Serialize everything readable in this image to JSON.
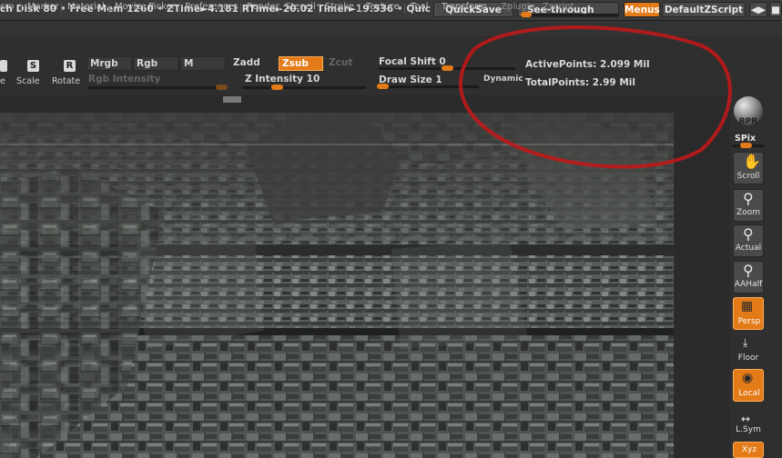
{
  "status_bar": {
    "disk": "ch Disk 80",
    "sep1": "•",
    "free_mem": "Free Mem 1260",
    "sep2": "•",
    "ztime": "ZTime►4.181",
    "rtime": "RTime►20.02",
    "timer": "Timer►19.536",
    "sep3": "•",
    "quick": "Quic"
  },
  "top_buttons": {
    "quicksave": "QuickSave",
    "see_through_label": "See-through",
    "see_through_value": "0",
    "see_through_fraction": 0,
    "menus": "Menus",
    "default_zscript": "DefaultZScript"
  },
  "menu_items": [
    "cro",
    "Marker",
    "Material",
    "Movie",
    "Picker",
    "Preferences",
    "Render",
    "Stencil",
    "Stroke",
    "Texture",
    "Tool",
    "Transform",
    "Zplugin",
    "Zscript"
  ],
  "tools": {
    "scale_label": "Scale",
    "rotate_label": "Rotate",
    "scale_key": "S",
    "rotate_key": "R",
    "first_label": "e"
  },
  "color_modes": {
    "mrgb": "Mrgb",
    "rgb": "Rgb",
    "m": "M",
    "rgb_intensity": "Rgb Intensity"
  },
  "z_modes": {
    "zadd": "Zadd",
    "zsub": "Zsub",
    "zcut": "Zcut",
    "z_intensity_label": "Z Intensity",
    "z_intensity_value": "10"
  },
  "brush": {
    "focal_shift_label": "Focal Shift",
    "focal_shift_value": "0",
    "draw_size_label": "Draw Size",
    "draw_size_value": "1",
    "dynamic_label": "Dynamic"
  },
  "stats": {
    "active_points": "ActivePoints: 2.099 Mil",
    "total_points": "TotalPoints: 2.99 Mil"
  },
  "right_shelf": {
    "bpr": "BPR",
    "spix": "SPix",
    "scroll": "Scroll",
    "zoom": "Zoom",
    "actual": "Actual",
    "aahalf": "AAHalf",
    "persp": "Persp",
    "floor": "Floor",
    "local": "Local",
    "lsym": "L.Sym",
    "xyz": "Xyz"
  },
  "colors": {
    "accent_orange": "#e37b18",
    "annotation_red": "#c01818"
  }
}
